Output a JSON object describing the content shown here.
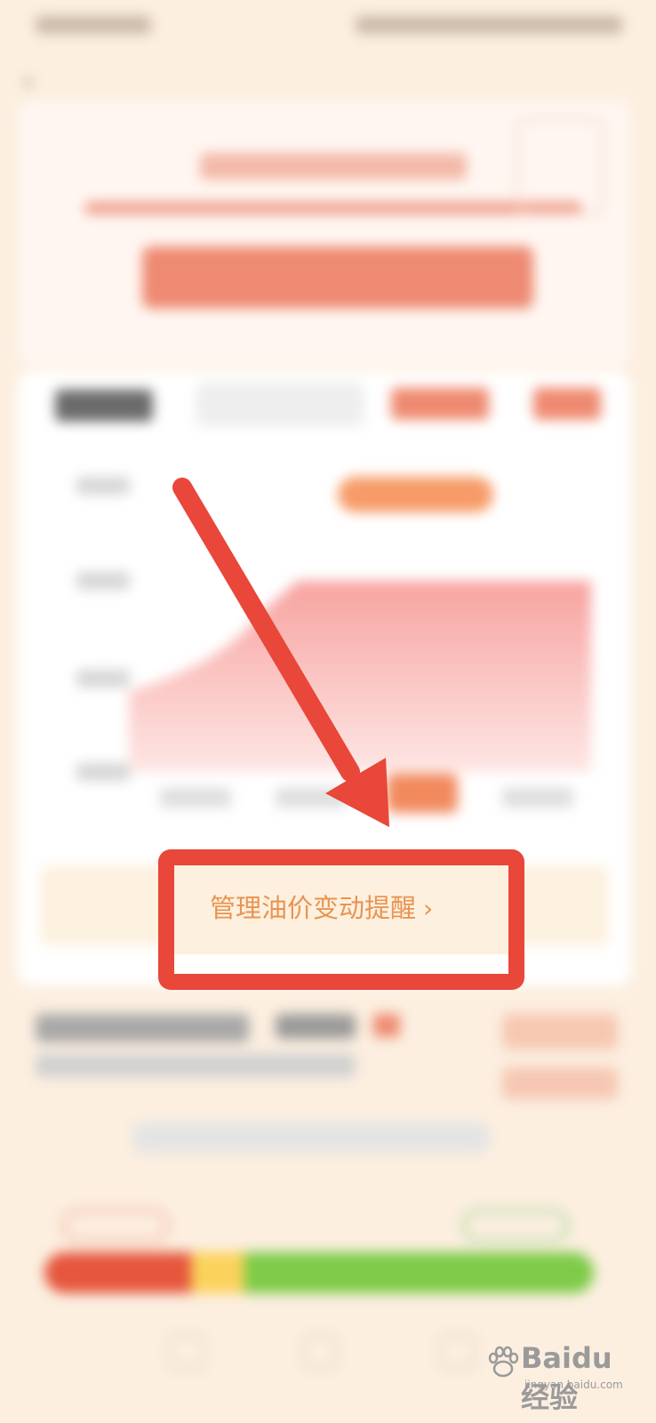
{
  "reminder": {
    "label": "管理油价变动提醒",
    "chevron": "›"
  },
  "watermark": {
    "brand": "Baidu经验",
    "site": "jingyan.baidu.com"
  },
  "colors": {
    "annotation_red": "#e8473a",
    "reminder_text": "#e89452",
    "background": "#fcefe0",
    "bar_red": "#e5563d",
    "bar_yellow": "#fbd25b",
    "bar_green": "#7dcb47"
  },
  "icons": [
    "back-arrow-icon",
    "chevron-right-icon",
    "baidu-paw-icon"
  ]
}
